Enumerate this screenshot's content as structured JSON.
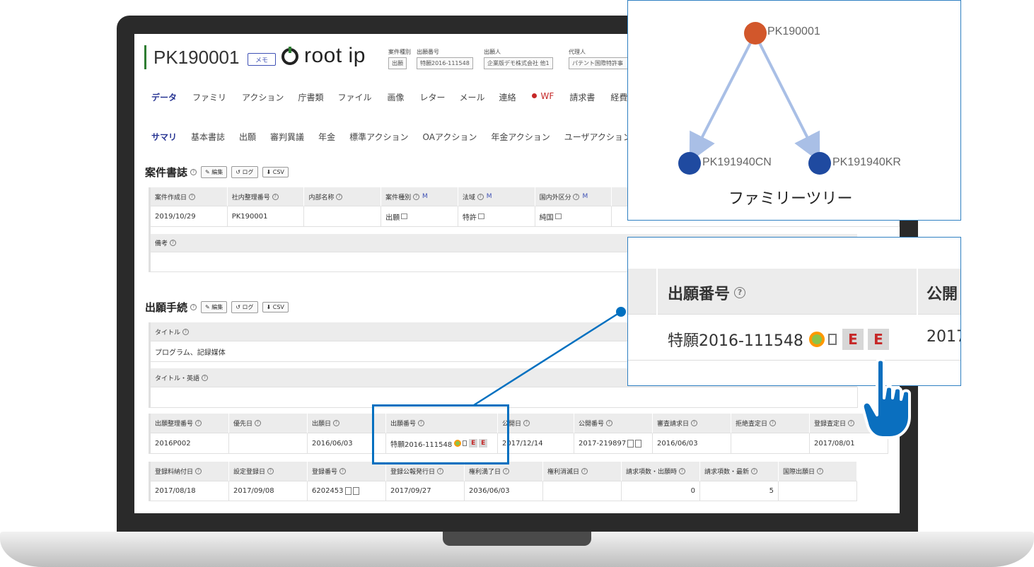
{
  "header": {
    "case_id": "PK190001",
    "memo_label": "メモ",
    "logo_text": "root ip",
    "case_type_label": "案件種別",
    "case_type_value": "出願",
    "app_number_label": "出願番号",
    "app_number_value": "特願2016-111548",
    "applicant_label": "出願人",
    "applicant_value": "企業版デモ株式会社 他1",
    "agent_label": "代理人",
    "agent_value": "パテント国際特許事"
  },
  "tabs_primary": [
    "データ",
    "ファミリ",
    "アクション",
    "庁書類",
    "ファイル",
    "画像",
    "レター",
    "メール",
    "連絡",
    "WF",
    "請求書",
    "経費"
  ],
  "tabs_secondary": [
    "サマリ",
    "基本書誌",
    "出願",
    "審判異議",
    "年金",
    "標準アクション",
    "OAアクション",
    "年金アクション",
    "ユーザアクション"
  ],
  "case_section": {
    "title": "案件書誌",
    "edit_label": "編集",
    "log_label": "ログ",
    "csv_label": "CSV",
    "headers": [
      "案件作成日",
      "社内整理番号",
      "内部名称",
      "案件種別",
      "法域",
      "国内外区分"
    ],
    "values": [
      "2019/10/29",
      "PK190001",
      "",
      "出願",
      "特許",
      "純国"
    ],
    "m_label": "M",
    "note_label": "備考"
  },
  "filing_section": {
    "title": "出願手続",
    "edit_label": "編集",
    "log_label": "ログ",
    "csv_label": "CSV",
    "title_label": "タイトル",
    "title_value": "プログラム、記録媒体",
    "title_en_label": "タイトル・英語",
    "row1_headers": [
      "出願整理番号",
      "優先日",
      "出願日",
      "出願番号",
      "公開日",
      "公開番号",
      "審査請求日",
      "拒絶査定日",
      "登録査定日"
    ],
    "row1_values": [
      "2016P002",
      "",
      "2016/06/03",
      "特願2016-111548",
      "2017/12/14",
      "2017-219897",
      "2016/06/03",
      "",
      "2017/08/01"
    ],
    "row2_headers": [
      "登録料納付日",
      "設定登録日",
      "登録番号",
      "登録公報発行日",
      "権利満了日",
      "権利消滅日",
      "請求項数・出願時",
      "請求項数・最新",
      "国際出願日"
    ],
    "row2_values": [
      "2017/08/18",
      "2017/09/08",
      "6202453",
      "2017/09/27",
      "2036/06/03",
      "",
      "0",
      "5",
      ""
    ],
    "e_badge": "E"
  },
  "family_tree": {
    "caption": "ファミリーツリー",
    "root": "PK190001",
    "children": [
      "PK191940CN",
      "PK191940KR"
    ],
    "colors": {
      "root": "#d2572b",
      "child": "#1f4aa0",
      "edge": "#a9bfe6"
    }
  },
  "zoom": {
    "header_app_number": "出願番号",
    "header_next": "公開",
    "app_number_value": "特願2016-111548",
    "next_value": "2017",
    "e_badge": "E"
  },
  "colors": {
    "accent": "#283593",
    "highlight": "#0070c0",
    "pointer": "#0a6fbf"
  }
}
